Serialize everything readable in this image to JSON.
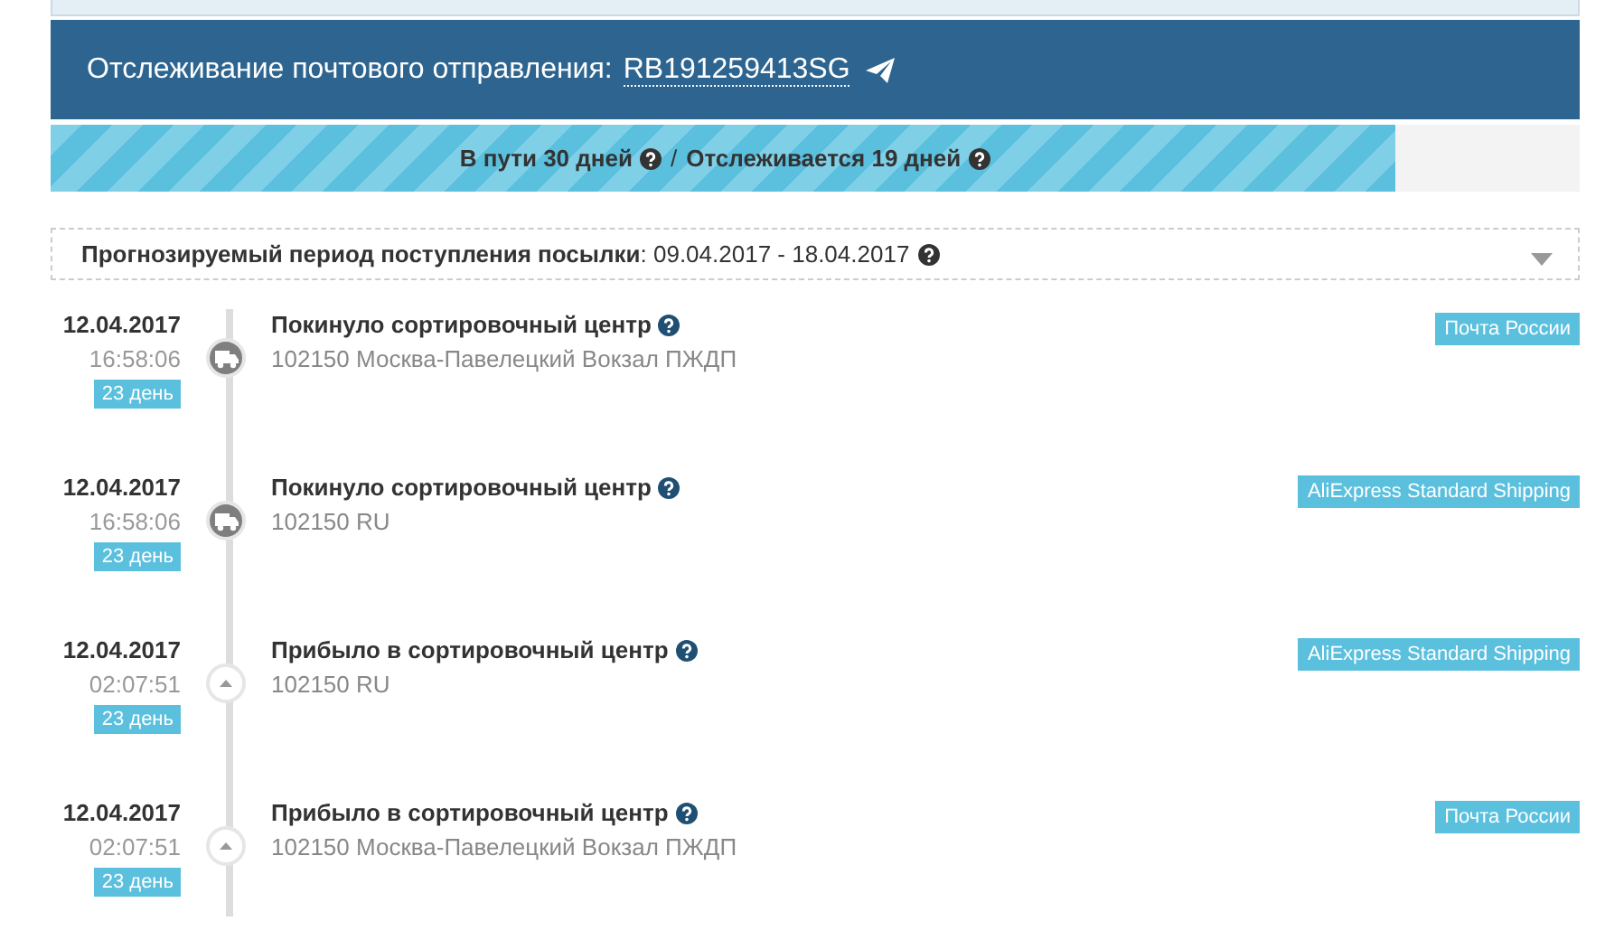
{
  "header": {
    "title": "Отслеживание почтового отправления:",
    "tracking_number": "RB191259413SG"
  },
  "progress": {
    "level": 0.88,
    "in_transit": "В пути 30 дней",
    "separator": "/",
    "tracked": "Отслеживается 19 дней"
  },
  "forecast": {
    "label": "Прогнозируемый период поступления посылки",
    "value": ": 09.04.2017 - 18.04.2017",
    "expanded": false
  },
  "events": [
    {
      "kind": "truck",
      "date": "12.04.2017",
      "time": "16:58:06",
      "day": "23 день",
      "status": "Покинуло сортировочный центр",
      "location": "102150 Москва-Павелецкий Вокзал ПЖДП",
      "source": "Почта России"
    },
    {
      "kind": "truck",
      "date": "12.04.2017",
      "time": "16:58:06",
      "day": "23 день",
      "status": "Покинуло сортировочный центр",
      "location": "102150 RU",
      "source": "AliExpress Standard Shipping"
    },
    {
      "kind": "arrival",
      "date": "12.04.2017",
      "time": "02:07:51",
      "day": "23 день",
      "status": "Прибыло в сортировочный центр",
      "location": "102150 RU",
      "source": "AliExpress Standard Shipping"
    },
    {
      "kind": "arrival",
      "date": "12.04.2017",
      "time": "02:07:51",
      "day": "23 день",
      "status": "Прибыло в сортировочный центр",
      "location": "102150 Москва-Павелецкий Вокзал ПЖДП",
      "source": "Почта России"
    }
  ]
}
